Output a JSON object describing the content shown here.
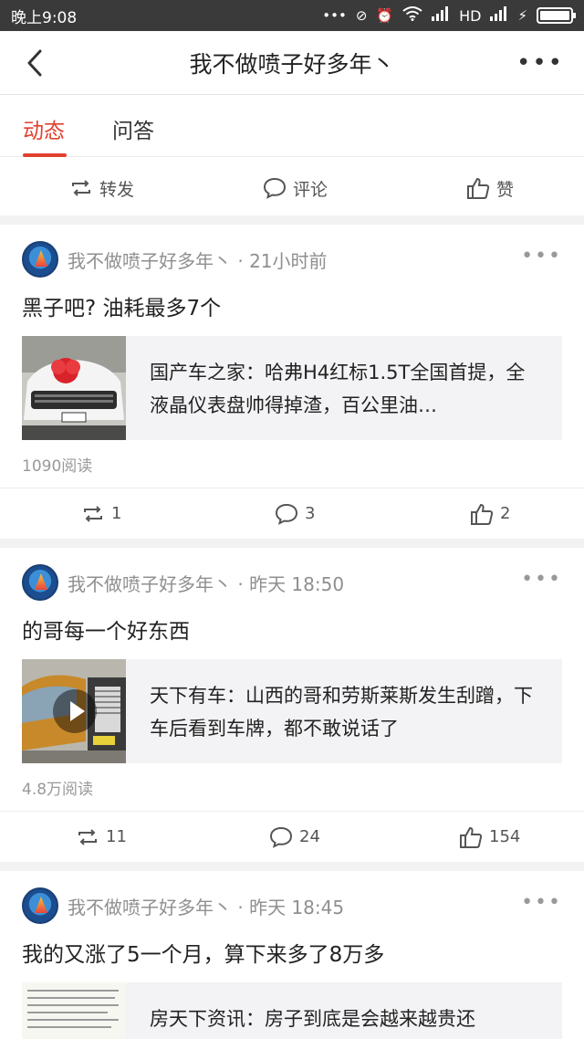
{
  "status_bar": {
    "time": "晚上9:08",
    "network": "HD",
    "icons": [
      "more-dots-icon",
      "link-icon",
      "alarm-icon",
      "wifi-icon",
      "signal-icon",
      "signal-icon",
      "charging-icon",
      "battery-icon"
    ]
  },
  "nav": {
    "title": "我不做喷子好多年丶",
    "back_icon": "chevron-left-icon",
    "more_label": "•••"
  },
  "tabs": [
    {
      "label": "动态",
      "active": true
    },
    {
      "label": "问答",
      "active": false
    }
  ],
  "top_actions": {
    "repost": "转发",
    "comment": "评论",
    "like": "赞"
  },
  "posts": [
    {
      "author": "我不做喷子好多年丶",
      "time": "· 21小时前",
      "text": "黑子吧? 油耗最多7个",
      "card_text": "国产车之家：哈弗H4红标1.5T全国首提，全液晶仪表盘帅得掉渣，百公里油…",
      "reads": "1090阅读",
      "repost": "1",
      "comment": "3",
      "like": "2",
      "video": false
    },
    {
      "author": "我不做喷子好多年丶",
      "time": "· 昨天 18:50",
      "text": "的哥每一个好东西",
      "card_text": "天下有车：山西的哥和劳斯莱斯发生刮蹭，下车后看到车牌，都不敢说话了",
      "reads": "4.8万阅读",
      "repost": "11",
      "comment": "24",
      "like": "154",
      "video": true
    },
    {
      "author": "我不做喷子好多年丶",
      "time": "· 昨天 18:45",
      "text": "我的又涨了5一个月，算下来多了8万多",
      "card_text": "房天下资讯：房子到底是会越来越贵还"
    }
  ],
  "colors": {
    "accent": "#e0412f",
    "status_bar": "#3a3a3a",
    "card_bg": "#f3f3f5"
  }
}
